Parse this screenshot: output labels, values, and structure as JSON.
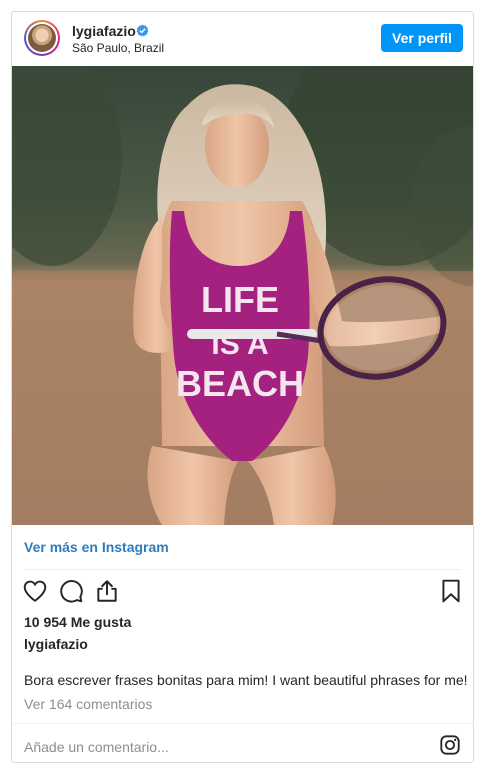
{
  "post": {
    "username": "lygiafazio",
    "location": "São Paulo, Brazil",
    "view_profile_label": "Ver perfil",
    "view_more_label": "Ver más en Instagram",
    "likes": "10 954 Me gusta",
    "caption_username": "lygiafazio",
    "caption": "Bora escrever frases bonitas para mim! I want beautiful phrases for me!",
    "view_comments_label": "Ver 164 comentarios",
    "add_comment_placeholder": "Añade un comentario..."
  },
  "photo": {
    "swimsuit_text_line1": "LIFE",
    "swimsuit_text_line2": "IS A",
    "swimsuit_text_line3": "BEACH"
  },
  "icons": {
    "verified": "verified-badge-icon",
    "like": "heart-icon",
    "comment": "comment-icon",
    "share": "share-icon",
    "save": "bookmark-icon",
    "instagram": "instagram-logo-icon"
  },
  "colors": {
    "accent": "#0095f6",
    "link": "#2f7bbf",
    "swimsuit": "#a4217f"
  }
}
